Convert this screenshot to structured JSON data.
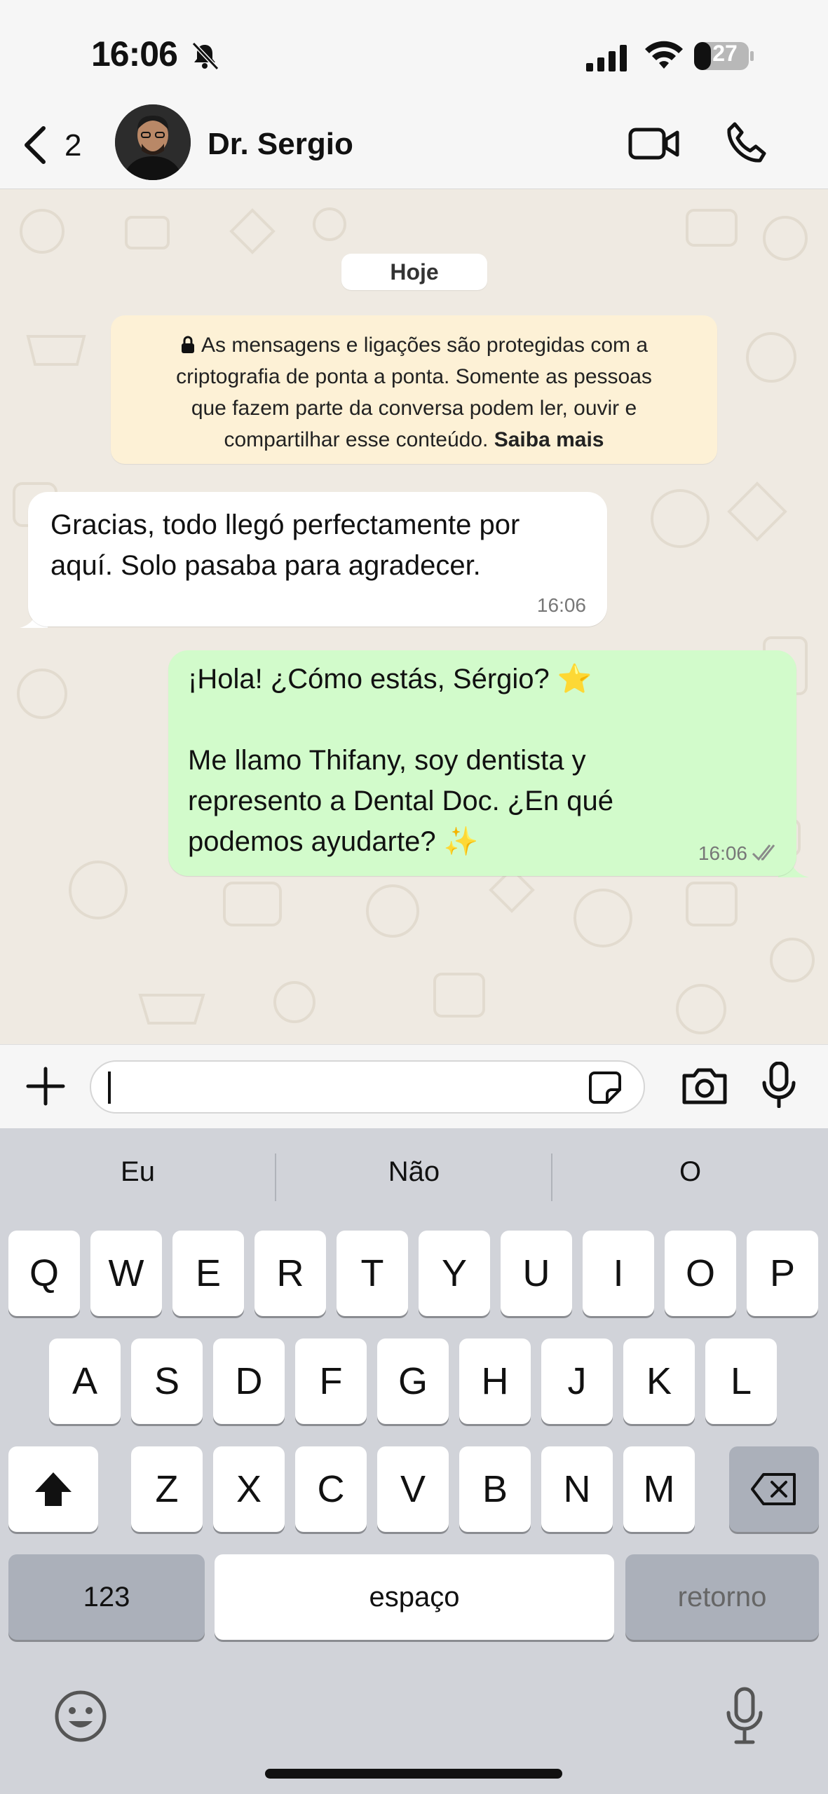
{
  "status_bar": {
    "time": "16:06",
    "battery": "27",
    "icons": [
      "bell-slash-icon",
      "cellular-signal-icon",
      "wifi-icon",
      "battery-icon"
    ]
  },
  "header": {
    "back_count": "2",
    "contact_name": "Dr. Sergio",
    "icons": [
      "chevron-left-icon",
      "video-call-icon",
      "phone-icon"
    ]
  },
  "chat": {
    "date_label": "Hoje",
    "encryption_notice": {
      "line1": "As mensagens e ligações são protegidas com a",
      "line2": "criptografia de ponta a ponta. Somente as pessoas",
      "line3": "que fazem parte da conversa podem ler, ouvir e",
      "line4": "compartilhar esse conteúdo.",
      "link": "Saiba mais"
    },
    "messages": [
      {
        "direction": "incoming",
        "lines": [
          "Gracias, todo llegó perfectamente por",
          "aquí. Solo pasaba para agradecer."
        ],
        "time": "16:06"
      },
      {
        "direction": "outgoing",
        "lines": [
          "¡Hola! ¿Cómo estás, Sérgio?",
          "Me llamo Thifany, soy dentista y",
          "represento a Dental Doc. ¿En qué",
          "podemos ayudarte?"
        ],
        "emojis": [
          "⭐",
          "✨"
        ],
        "time": "16:06",
        "status": "read"
      }
    ]
  },
  "composer": {
    "input_value": "",
    "icons": [
      "plus-icon",
      "sticker-icon",
      "camera-icon",
      "microphone-icon"
    ]
  },
  "keyboard": {
    "suggestions": [
      "Eu",
      "Não",
      "O"
    ],
    "row1": [
      "Q",
      "W",
      "E",
      "R",
      "T",
      "Y",
      "U",
      "I",
      "O",
      "P"
    ],
    "row2": [
      "A",
      "S",
      "D",
      "F",
      "G",
      "H",
      "J",
      "K",
      "L"
    ],
    "row3": [
      "Z",
      "X",
      "C",
      "V",
      "B",
      "N",
      "M"
    ],
    "numbers_key": "123",
    "space_key": "espaço",
    "return_key": "retorno",
    "icons": [
      "shift-icon",
      "backspace-icon",
      "emoji-icon",
      "dictation-mic-icon"
    ]
  },
  "colors": {
    "chat_background": "#efeae2",
    "outgoing_bubble": "#d2fbcb",
    "incoming_bubble": "#ffffff",
    "encryption_notice_bg": "#fdf1d6",
    "keyboard_bg": "#d1d3d9"
  }
}
